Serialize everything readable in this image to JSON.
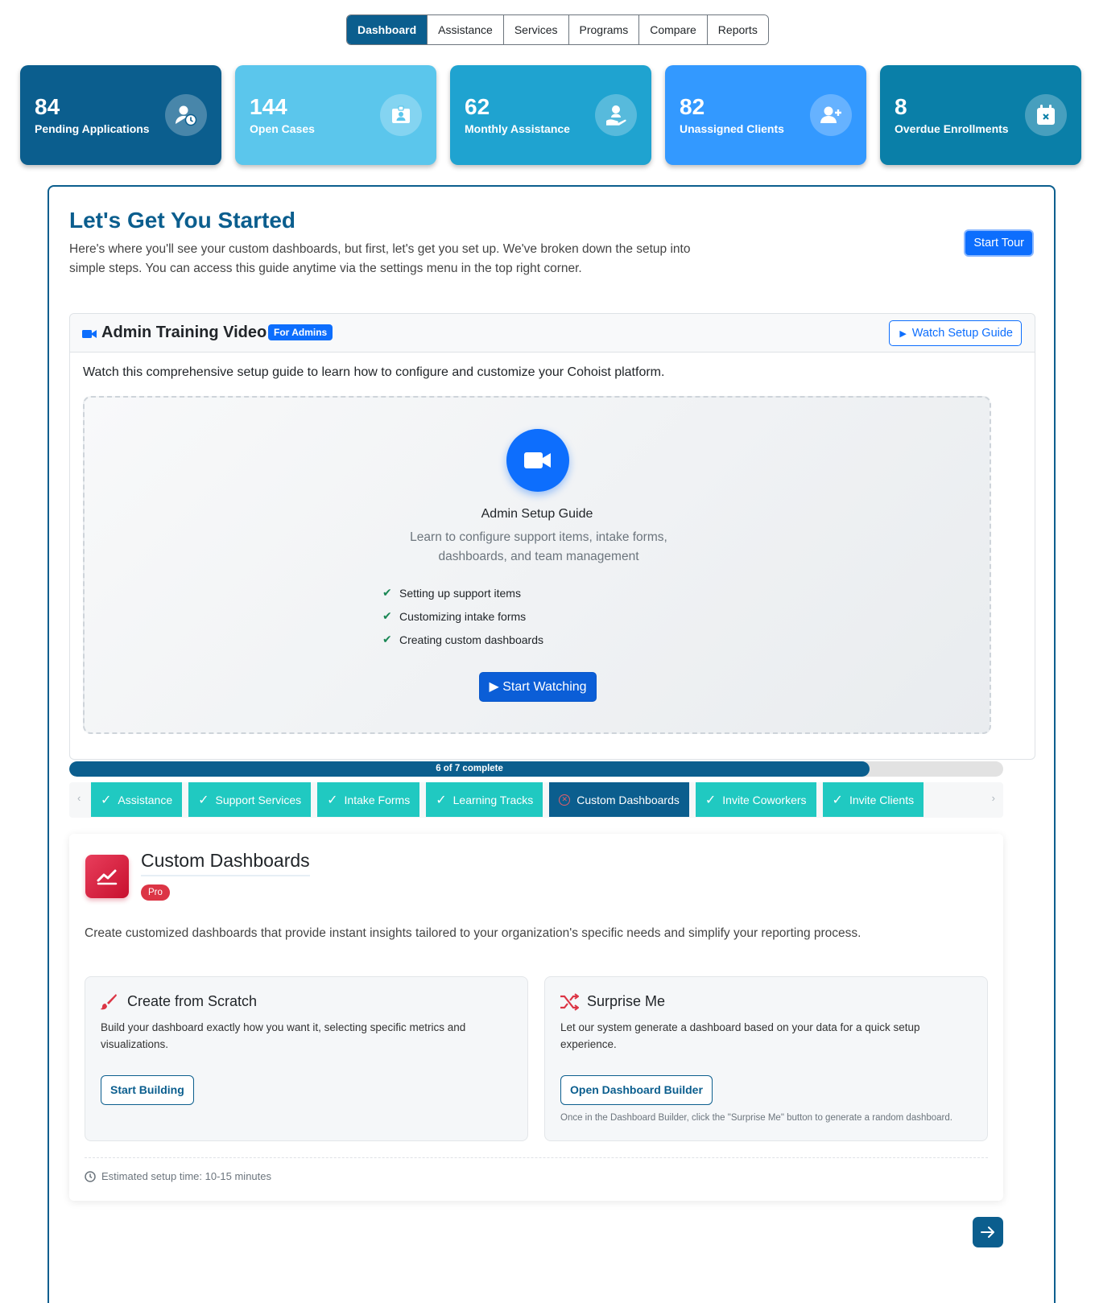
{
  "nav": {
    "tabs": [
      "Dashboard",
      "Assistance",
      "Services",
      "Programs",
      "Compare",
      "Reports"
    ],
    "active": "Dashboard"
  },
  "stats": [
    {
      "value": "84",
      "label": "Pending Applications",
      "icon": "user-clock-icon",
      "color": "#0b5e8e"
    },
    {
      "value": "144",
      "label": "Open Cases",
      "icon": "id-card-icon",
      "color": "#5bc6ec"
    },
    {
      "value": "62",
      "label": "Monthly Assistance",
      "icon": "hand-holding-user-icon",
      "color": "#1fa3d0"
    },
    {
      "value": "82",
      "label": "Unassigned Clients",
      "icon": "user-plus-icon",
      "color": "#3399ff"
    },
    {
      "value": "8",
      "label": "Overdue Enrollments",
      "icon": "calendar-x-icon",
      "color": "#0a7fa8"
    }
  ],
  "hero": {
    "title": "Let's Get You Started",
    "subtitle": "Here's where you'll see your custom dashboards, but first, let's get you set up. We've broken down the setup into simple steps. You can access this guide anytime via the settings menu in the top right corner.",
    "tour_button": "Start Tour"
  },
  "training": {
    "title": "Admin Training Video",
    "badge": "For Admins",
    "watch_button": "Watch Setup Guide",
    "description": "Watch this comprehensive setup guide to learn how to configure and customize your Cohoist platform.",
    "video_title": "Admin Setup Guide",
    "video_subtitle": "Learn to configure support items, intake forms, dashboards, and team management",
    "checklist": [
      "Setting up support items",
      "Customizing intake forms",
      "Creating custom dashboards"
    ],
    "start_button": "▶ Start Watching"
  },
  "progress": {
    "label": "6 of 7 complete",
    "fraction": 0.857
  },
  "steps": [
    {
      "label": "Assistance",
      "done": true
    },
    {
      "label": "Support Services",
      "done": true
    },
    {
      "label": "Intake Forms",
      "done": true
    },
    {
      "label": "Learning Tracks",
      "done": true
    },
    {
      "label": "Custom Dashboards",
      "done": false,
      "active": true
    },
    {
      "label": "Invite Coworkers",
      "done": true
    },
    {
      "label": "Invite Clients",
      "done": true
    }
  ],
  "panel": {
    "title": "Custom Dashboards",
    "badge": "Pro",
    "description": "Create customized dashboards that provide instant insights tailored to your organization's specific needs and simplify your reporting process.",
    "options": [
      {
        "title": "Create from Scratch",
        "description": "Build your dashboard exactly how you want it, selecting specific metrics and visualizations.",
        "button": "Start Building",
        "note": ""
      },
      {
        "title": "Surprise Me",
        "description": "Let our system generate a dashboard based on your data for a quick setup experience.",
        "button": "Open Dashboard Builder",
        "note": "Once in the Dashboard Builder, click the \"Surprise Me\" button to generate a random dashboard."
      }
    ],
    "estimate": "Estimated setup time: 10-15 minutes"
  },
  "colors": {
    "primary": "#0b5e8e",
    "teal": "#20c9c1",
    "blue": "#0d6efd",
    "pro": "#dc3545"
  }
}
